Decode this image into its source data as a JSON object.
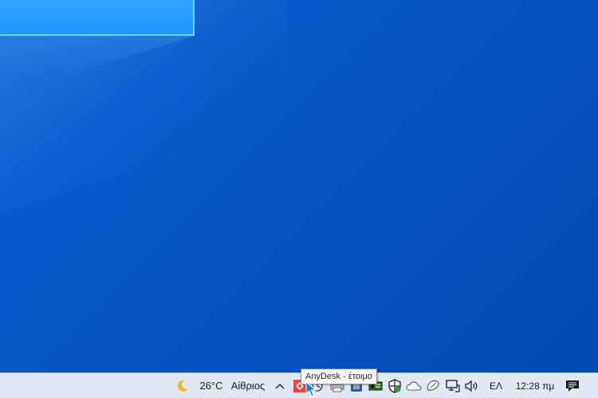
{
  "desktop": {
    "background_color": "#0757c7"
  },
  "taskbar": {
    "weather": {
      "icon": "moon-icon",
      "temperature": "26°C",
      "description": "Αίθριος"
    },
    "show_hidden_icons": "chevron-up-icon",
    "tray_icons": [
      "anydesk-icon",
      "network-activity-icon",
      "printer-icon",
      "app-icon",
      "gpu-icon",
      "security-shield-icon",
      "onedrive-cloud-icon",
      "mouse-icon",
      "network-monitor-icon",
      "volume-icon"
    ],
    "language": "ΕΛ",
    "clock": "12:28 πμ",
    "notifications": "action-center-icon"
  },
  "tooltip": {
    "text": "AnyDesk - έτοιμο"
  }
}
